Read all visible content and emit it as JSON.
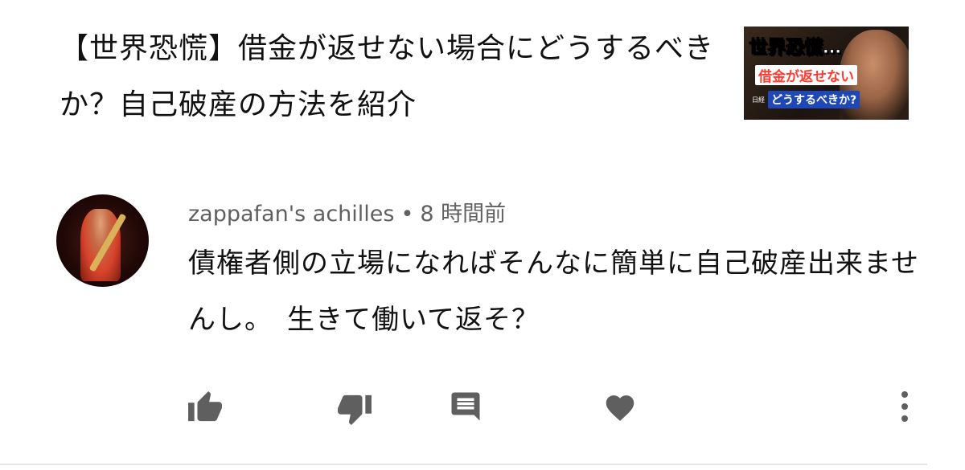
{
  "video": {
    "title": "【世界恐慌】借金が返せない場合にどうするべきか？自己破産の方法を紹介",
    "thumbnail": {
      "line1": "世界恐慌…",
      "line2": "借金が返せない",
      "line3": "どうするべきか?",
      "tag": "日経"
    }
  },
  "comment": {
    "author": "zappafan's achilles",
    "separator": "•",
    "time": "8 時間前",
    "text": "債権者側の立場になればそんなに簡単に自己破産出来ませんし。　生きて働いて返そ？"
  },
  "actions": {
    "like_icon": "thumb-up-icon",
    "dislike_icon": "thumb-down-icon",
    "reply_icon": "comment-icon",
    "heart_icon": "heart-icon",
    "more_icon": "more-vertical-icon"
  },
  "colors": {
    "icon": "#5f5f5f",
    "meta_text": "#606060",
    "body_text": "#111111",
    "divider": "#e5e5e5"
  }
}
